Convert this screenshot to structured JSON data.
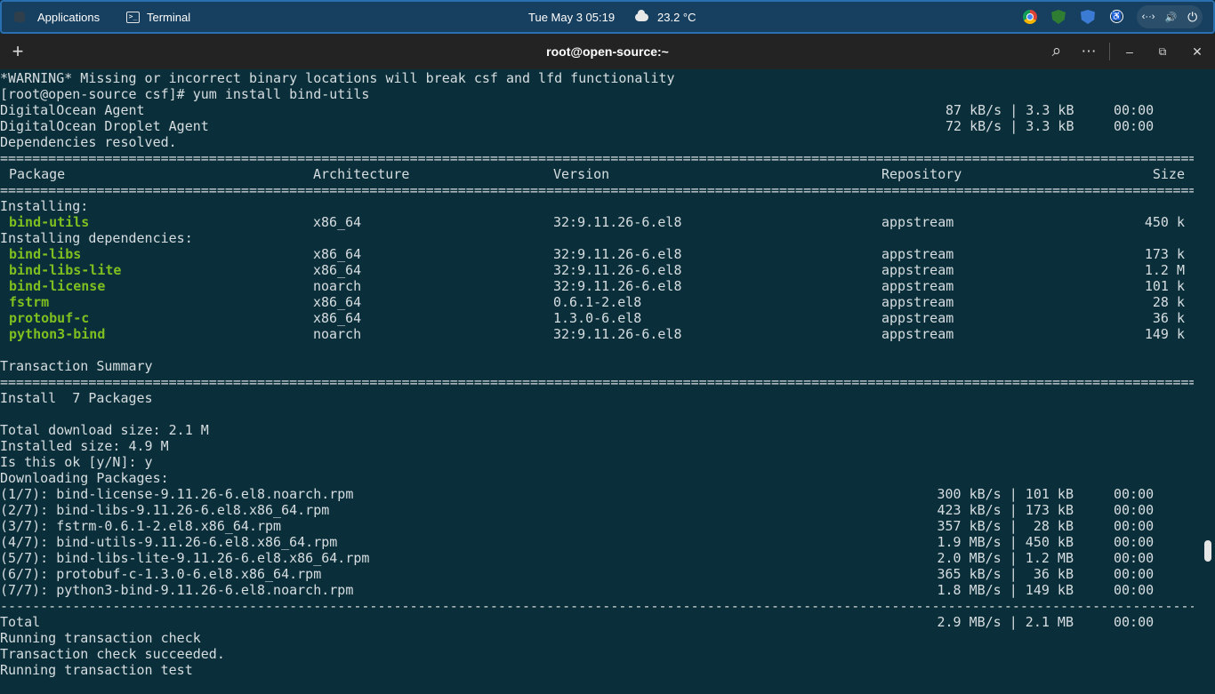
{
  "topbar": {
    "applications": "Applications",
    "active_app": "Terminal",
    "term_glyph": ">_",
    "clock": "Tue May 3  05:19",
    "weather": "23.2 °C",
    "tray_icons": [
      "chrome-icon",
      "shield-icon",
      "bitwarden-icon",
      "accessibility-icon"
    ],
    "sys_icons": [
      "network-icon",
      "volume-icon",
      "power-icon"
    ],
    "network_glyph": "‹··›",
    "volume_glyph": "🔊",
    "power_glyph": "⏻",
    "access_glyph": "♿"
  },
  "window": {
    "title": "root@open-source:~",
    "new_tab": "+",
    "search": "⌕",
    "menu": "⋯",
    "minimize": "–",
    "maximize": "⧉",
    "close": "✕"
  },
  "terminal": {
    "warning": "*WARNING* Missing or incorrect binary locations will break csf and lfd functionality",
    "prompt": "[root@open-source csf]# yum install bind-utils",
    "repos": [
      {
        "name": "DigitalOcean Agent",
        "rate": "87 kB/s | 3.3 kB",
        "time": "00:00"
      },
      {
        "name": "DigitalOcean Droplet Agent",
        "rate": "72 kB/s | 3.3 kB",
        "time": "00:00"
      }
    ],
    "deps_resolved": "Dependencies resolved.",
    "rule_eq": "==============================================================================================================================================================================",
    "rule_dash": "------------------------------------------------------------------------------------------------------------------------------------------------------------------------------",
    "headers": {
      "package": "Package",
      "arch": "Architecture",
      "version": "Version",
      "repo": "Repository",
      "size": "Size"
    },
    "installing_label": "Installing:",
    "main_pkg": {
      "name": "bind-utils",
      "arch": "x86_64",
      "version": "32:9.11.26-6.el8",
      "repo": "appstream",
      "size": "450 k"
    },
    "deps_label": "Installing dependencies:",
    "deps": [
      {
        "name": "bind-libs",
        "arch": "x86_64",
        "version": "32:9.11.26-6.el8",
        "repo": "appstream",
        "size": "173 k"
      },
      {
        "name": "bind-libs-lite",
        "arch": "x86_64",
        "version": "32:9.11.26-6.el8",
        "repo": "appstream",
        "size": "1.2 M"
      },
      {
        "name": "bind-license",
        "arch": "noarch",
        "version": "32:9.11.26-6.el8",
        "repo": "appstream",
        "size": "101 k"
      },
      {
        "name": "fstrm",
        "arch": "x86_64",
        "version": "0.6.1-2.el8",
        "repo": "appstream",
        "size": "28 k"
      },
      {
        "name": "protobuf-c",
        "arch": "x86_64",
        "version": "1.3.0-6.el8",
        "repo": "appstream",
        "size": "36 k"
      },
      {
        "name": "python3-bind",
        "arch": "noarch",
        "version": "32:9.11.26-6.el8",
        "repo": "appstream",
        "size": "149 k"
      }
    ],
    "summary_label": "Transaction Summary",
    "install_count": "Install  7 Packages",
    "total_download": "Total download size: 2.1 M",
    "installed_size": "Installed size: 4.9 M",
    "confirm": "Is this ok [y/N]: y",
    "downloading": "Downloading Packages:",
    "downloads": [
      {
        "file": "(1/7): bind-license-9.11.26-6.el8.noarch.rpm",
        "rate": "300 kB/s | 101 kB",
        "time": "00:00"
      },
      {
        "file": "(2/7): bind-libs-9.11.26-6.el8.x86_64.rpm",
        "rate": "423 kB/s | 173 kB",
        "time": "00:00"
      },
      {
        "file": "(3/7): fstrm-0.6.1-2.el8.x86_64.rpm",
        "rate": "357 kB/s |  28 kB",
        "time": "00:00"
      },
      {
        "file": "(4/7): bind-utils-9.11.26-6.el8.x86_64.rpm",
        "rate": "1.9 MB/s | 450 kB",
        "time": "00:00"
      },
      {
        "file": "(5/7): bind-libs-lite-9.11.26-6.el8.x86_64.rpm",
        "rate": "2.0 MB/s | 1.2 MB",
        "time": "00:00"
      },
      {
        "file": "(6/7): protobuf-c-1.3.0-6.el8.x86_64.rpm",
        "rate": "365 kB/s |  36 kB",
        "time": "00:00"
      },
      {
        "file": "(7/7): python3-bind-9.11.26-6.el8.noarch.rpm",
        "rate": "1.8 MB/s | 149 kB",
        "time": "00:00"
      }
    ],
    "total": {
      "label": "Total",
      "rate": "2.9 MB/s | 2.1 MB",
      "time": "00:00"
    },
    "trailing": [
      "Running transaction check",
      "Transaction check succeeded.",
      "Running transaction test"
    ]
  }
}
